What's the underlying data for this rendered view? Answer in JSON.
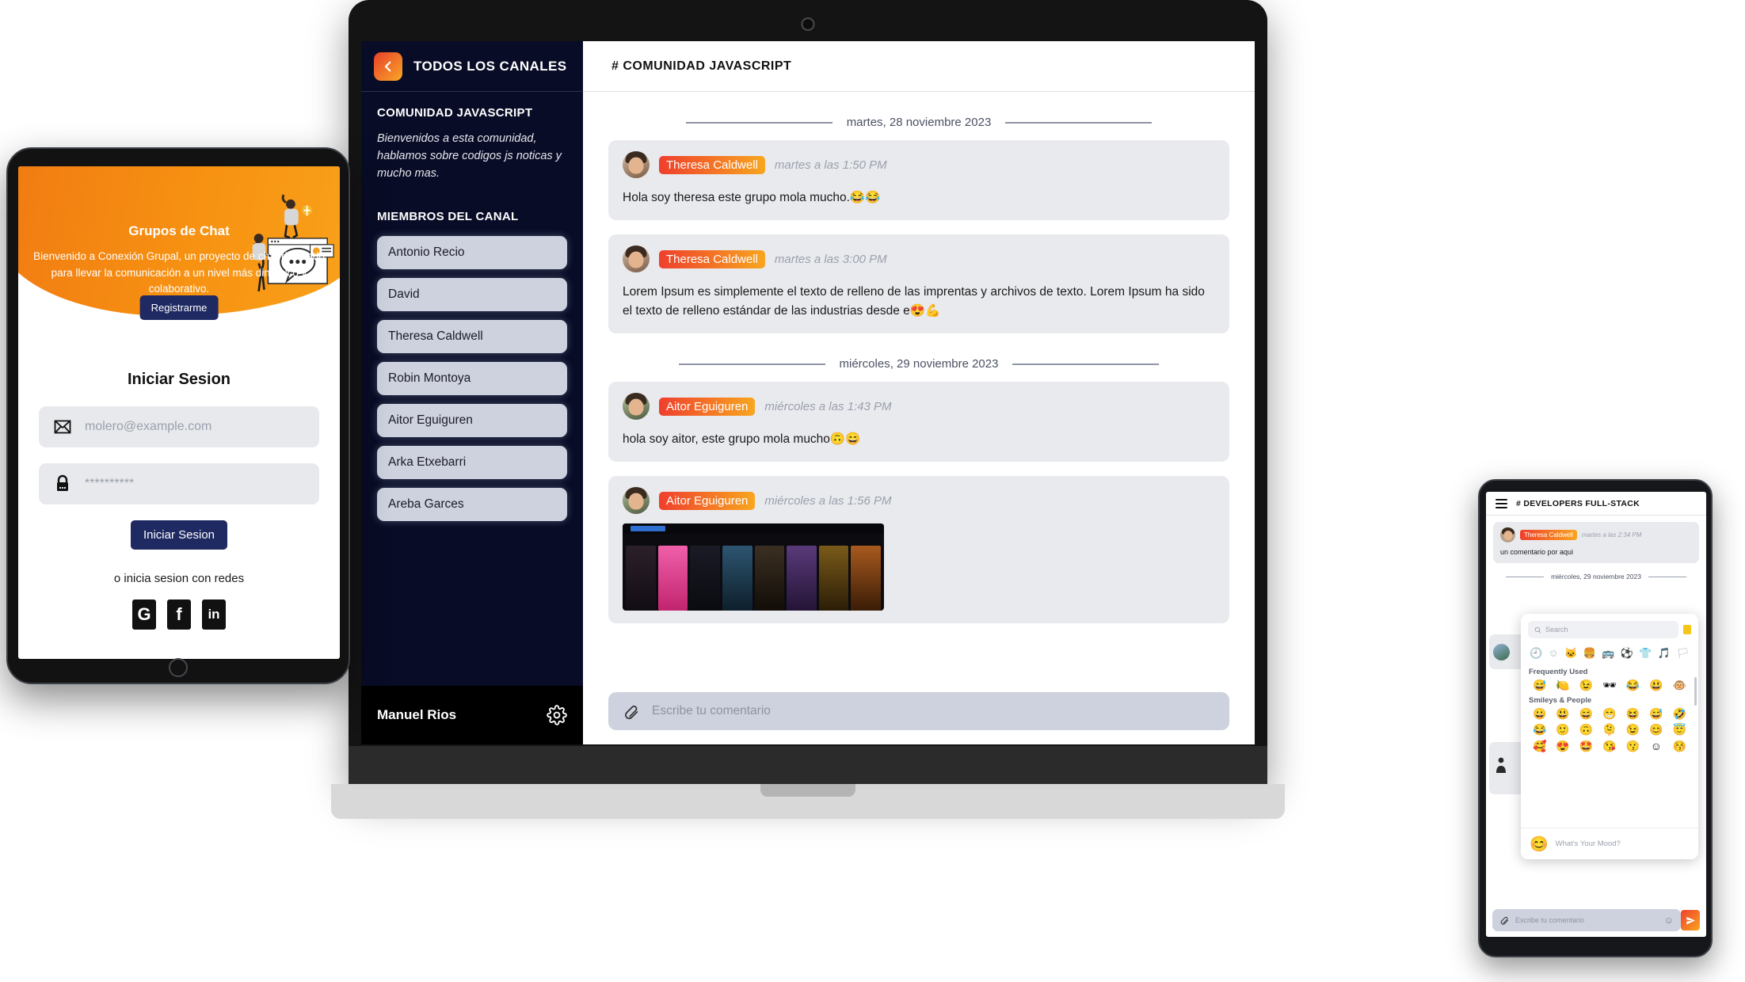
{
  "laptop": {
    "sidebar": {
      "back_icon": "chevron-left-icon",
      "top_title": "TODOS LOS CANALES",
      "channel_heading": "COMUNIDAD JAVASCRIPT",
      "channel_description": "Bienvenidos a esta comunidad, hablamos sobre codigos js noticas y mucho mas.",
      "members_heading": "MIEMBROS DEL CANAL",
      "members": [
        "Antonio Recio",
        "David",
        "Theresa Caldwell",
        "Robin Montoya",
        "Aitor Eguiguren",
        "Arka Etxebarri",
        "Areba Garces"
      ],
      "current_user": "Manuel Rios",
      "settings_icon": "gear-icon"
    },
    "chat": {
      "header_title": "# COMUNIDAD JAVASCRIPT",
      "separators": {
        "day1": "martes, 28 noviembre 2023",
        "day2": "miércoles, 29 noviembre 2023"
      },
      "messages": [
        {
          "author": "Theresa Caldwell",
          "time": "martes a las 1:50 PM",
          "text": "Hola soy theresa este grupo mola mucho.😂😂"
        },
        {
          "author": "Theresa Caldwell",
          "time": "martes a las 3:00 PM",
          "text": "Lorem Ipsum es simplemente el texto de relleno de las imprentas y archivos de texto. Lorem Ipsum ha sido el texto de relleno estándar de las industrias desde e😍💪"
        },
        {
          "author": "Aitor Eguiguren",
          "time": "miércoles a las 1:43 PM",
          "text": "hola soy aitor, este grupo mola mucho🙃😄"
        },
        {
          "author": "Aitor Eguiguren",
          "time": "miércoles a las 1:56 PM",
          "text": ""
        }
      ],
      "composer": {
        "attach_icon": "paperclip-icon",
        "placeholder": "Escribe tu comentario"
      }
    }
  },
  "tablet": {
    "hero": {
      "title": "Grupos de Chat",
      "subtitle": "Bienvenido a Conexión Grupal, un proyecto de chat diseñado para llevar la comunicación a un nivel más dinámico y colaborativo.",
      "register_label": "Registrarme"
    },
    "login": {
      "title": "Iniciar Sesion",
      "email_icon": "envelope-icon",
      "email_placeholder": "molero@example.com",
      "password_icon": "lock-icon",
      "password_value": "**********",
      "submit_label": "Iniciar Sesion",
      "social_text": "o inicia sesion con redes",
      "socials": [
        {
          "icon": "google-icon",
          "glyph": "G"
        },
        {
          "icon": "facebook-icon",
          "glyph": "f"
        },
        {
          "icon": "linkedin-icon",
          "glyph": "in"
        }
      ]
    }
  },
  "phone": {
    "menu_icon": "hamburger-menu-icon",
    "header_title": "# DEVELOPERS FULL-STACK",
    "message": {
      "author": "Theresa Caldwell",
      "time": "martes a las 2:34 PM",
      "text": "un comentario por aqui"
    },
    "day_separator": "miércoles, 29 noviembre 2023",
    "emoji_picker": {
      "search_icon": "magnifier-icon",
      "search_placeholder": "Search",
      "tabs": [
        "🕘",
        "☺",
        "🐱",
        "🍔",
        "🚌",
        "⚽",
        "👕",
        "🎵",
        "🏳"
      ],
      "frequently_used_label": "Frequently Used",
      "frequently_used": [
        "😅",
        "🍋",
        "😉",
        "🕶",
        "😂",
        "😃",
        "🐵"
      ],
      "smileys_label": "Smileys & People",
      "smileys": [
        "😀",
        "😃",
        "😄",
        "😁",
        "😆",
        "😅",
        "🤣",
        "😂",
        "🙂",
        "🙃",
        "🫠",
        "😉",
        "😊",
        "😇",
        "🥰",
        "😍",
        "🤩",
        "😘",
        "😗",
        "☺",
        "😚"
      ],
      "mood_emoji": "😊",
      "mood_label": "What's Your Mood?"
    },
    "composer": {
      "attach_icon": "paperclip-icon",
      "placeholder": "Escribe tu comentario",
      "emoji_icon": "smiley-icon",
      "send_icon": "send-icon"
    }
  },
  "colors": {
    "brand_orange": "#f8a61f",
    "brand_red": "#ef3f2d",
    "navy": "#1f2a62",
    "sidebar_bg": "#080c26",
    "bubble_bg": "#e9eaee"
  }
}
